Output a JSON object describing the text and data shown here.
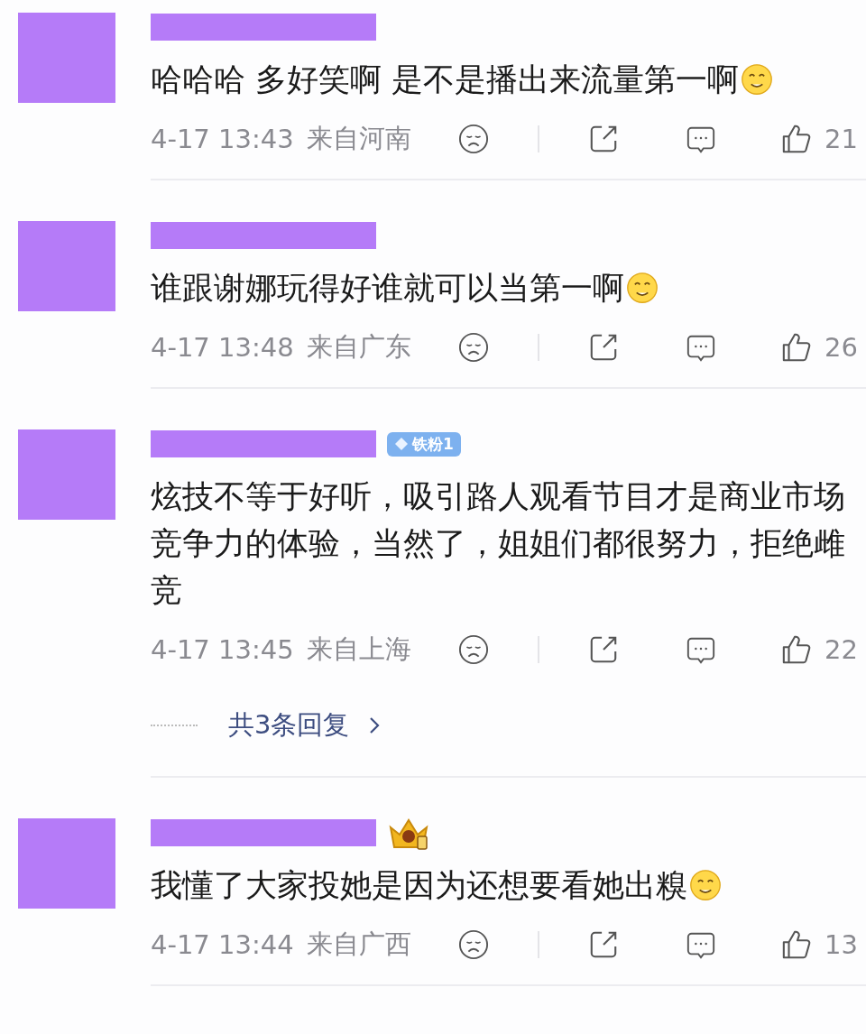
{
  "comments": [
    {
      "name_redacted": true,
      "vip": false,
      "text": "哈哈哈 多好笑啊 是不是播出来流量第一啊",
      "emoji": true,
      "time": "4-17 13:43",
      "location": "来自河南",
      "likes": "21"
    },
    {
      "name_redacted": true,
      "vip": false,
      "text": "谁跟谢娜玩得好谁就可以当第一啊",
      "emoji": true,
      "time": "4-17 13:48",
      "location": "来自广东",
      "likes": "26"
    },
    {
      "name_redacted": true,
      "vip": false,
      "badge": "铁粉1",
      "text": "炫技不等于好听，吸引路人观看节目才是商业市场竞争力的体验，当然了，姐姐们都很努力，拒绝雌竞",
      "emoji": false,
      "time": "4-17 13:45",
      "location": "来自上海",
      "likes": "22",
      "replies": "共3条回复"
    },
    {
      "name_redacted": true,
      "vip": true,
      "text": "我懂了大家投她是因为还想要看她出糗",
      "emoji": true,
      "time": "4-17 13:44",
      "location": "来自广西",
      "likes": "13"
    }
  ]
}
